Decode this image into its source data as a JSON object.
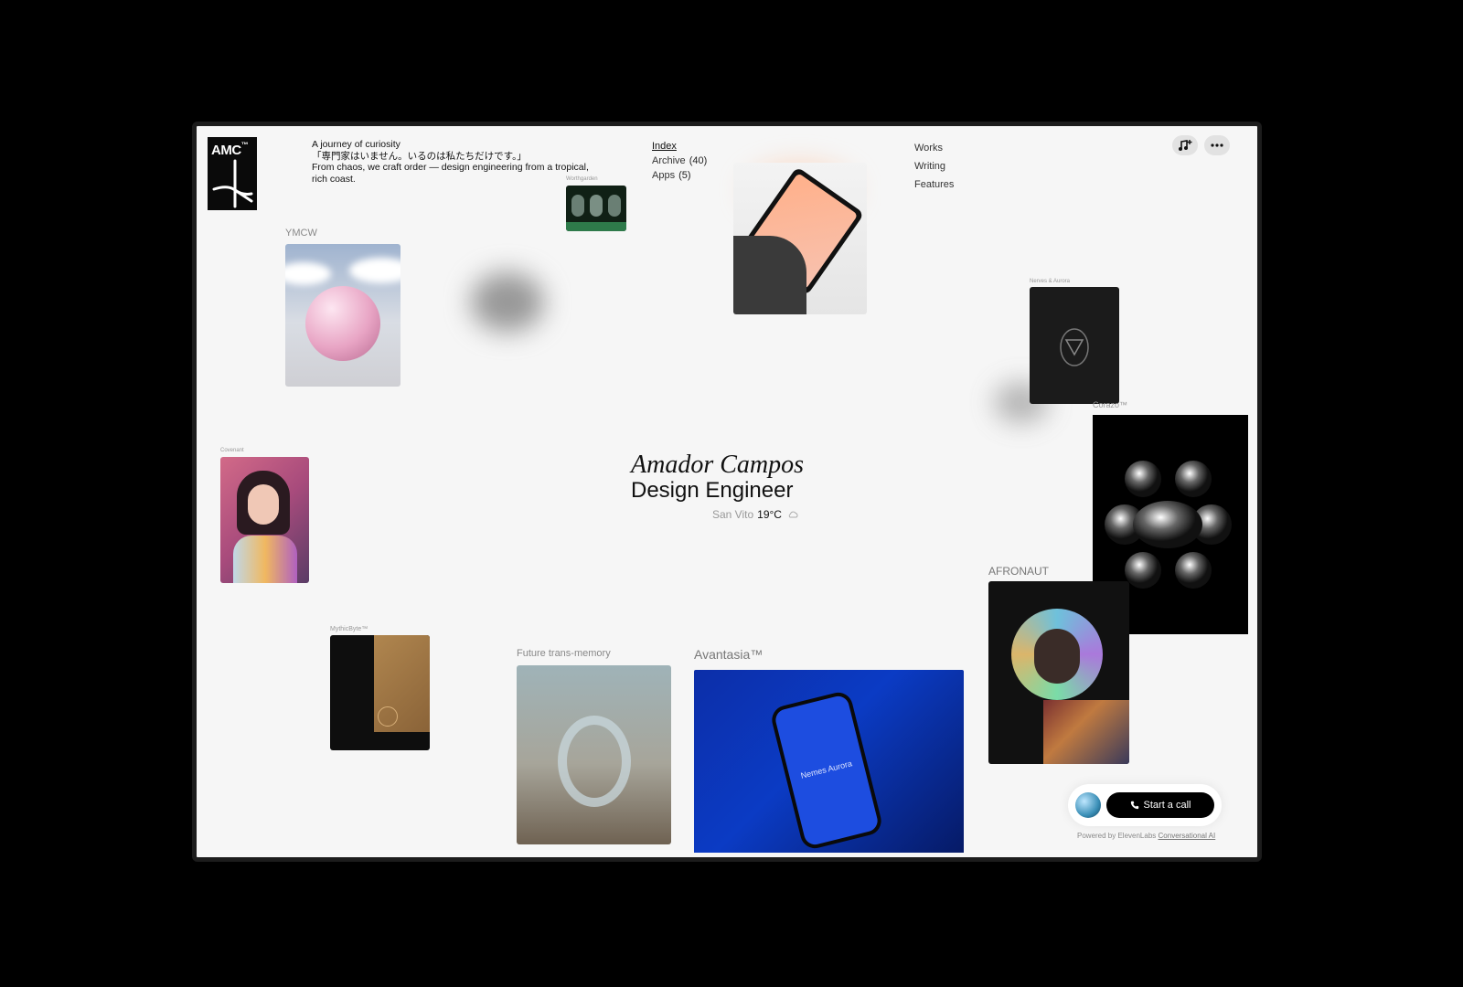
{
  "logo": {
    "text": "AMC",
    "mark": "™"
  },
  "tagline": {
    "line1": "A journey of curiosity",
    "line2": "「専門家はいません。いるのは私たちだけです。」",
    "line3": "From chaos, we craft order — design engineering from a tropical,",
    "line4": "rich coast."
  },
  "nav_mid": {
    "index": "Index",
    "archive": "Archive",
    "archive_count": "(40)",
    "apps": "Apps",
    "apps_count": "(5)"
  },
  "nav_right": {
    "works": "Works",
    "writing": "Writing",
    "features": "Features"
  },
  "toolbar": {
    "music_icon": "music-plus-icon",
    "more_icon": "more-dots-icon"
  },
  "projects": {
    "ymcw": "YMCW",
    "worthgarden": "Worthgarden",
    "nerves": "Nerves & Aurora",
    "covenant": "Covenant",
    "corazon": "Corazo™",
    "afronaut": "AFRONAUT",
    "mythicbyte": "MythicByte™",
    "future": "Future trans-memory",
    "avantasia": "Avantasia™",
    "phone_text": "Nemes Aurora"
  },
  "hero": {
    "name": "Amador Campos",
    "role": "Design Engineer",
    "city": "San Vito",
    "temp": "19°C",
    "weather_icon": "cloud-icon"
  },
  "call": {
    "button_label": "Start a call",
    "phone_icon": "phone-icon",
    "powered_prefix": "Powered by ElevenLabs",
    "powered_link": "Conversational AI"
  },
  "colors": {
    "page_bg": "#f6f6f6",
    "button": "#000000",
    "accent_blue": "#0b3bc4"
  }
}
